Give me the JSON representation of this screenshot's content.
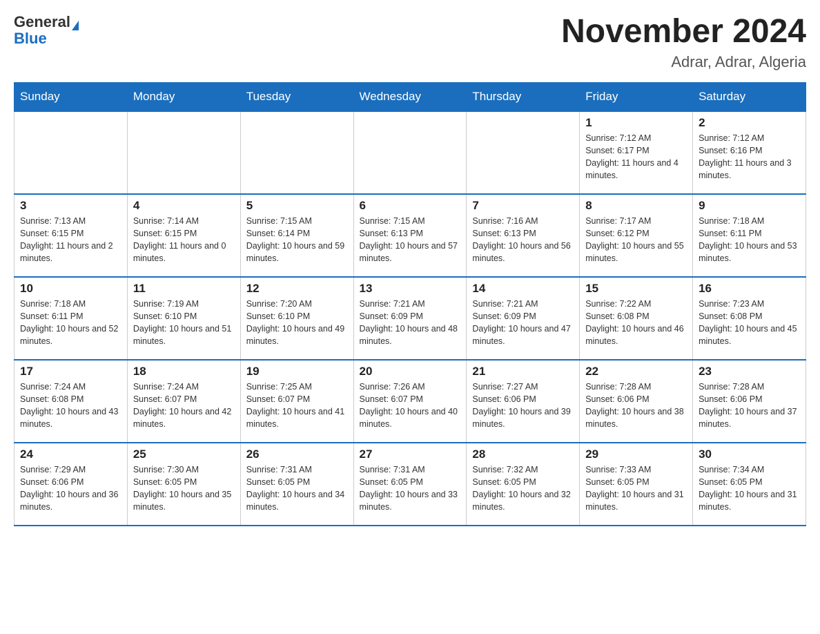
{
  "header": {
    "logo_general": "General",
    "logo_blue": "Blue",
    "month_title": "November 2024",
    "location": "Adrar, Adrar, Algeria"
  },
  "weekdays": [
    "Sunday",
    "Monday",
    "Tuesday",
    "Wednesday",
    "Thursday",
    "Friday",
    "Saturday"
  ],
  "weeks": [
    [
      {
        "day": "",
        "info": ""
      },
      {
        "day": "",
        "info": ""
      },
      {
        "day": "",
        "info": ""
      },
      {
        "day": "",
        "info": ""
      },
      {
        "day": "",
        "info": ""
      },
      {
        "day": "1",
        "info": "Sunrise: 7:12 AM\nSunset: 6:17 PM\nDaylight: 11 hours and 4 minutes."
      },
      {
        "day": "2",
        "info": "Sunrise: 7:12 AM\nSunset: 6:16 PM\nDaylight: 11 hours and 3 minutes."
      }
    ],
    [
      {
        "day": "3",
        "info": "Sunrise: 7:13 AM\nSunset: 6:15 PM\nDaylight: 11 hours and 2 minutes."
      },
      {
        "day": "4",
        "info": "Sunrise: 7:14 AM\nSunset: 6:15 PM\nDaylight: 11 hours and 0 minutes."
      },
      {
        "day": "5",
        "info": "Sunrise: 7:15 AM\nSunset: 6:14 PM\nDaylight: 10 hours and 59 minutes."
      },
      {
        "day": "6",
        "info": "Sunrise: 7:15 AM\nSunset: 6:13 PM\nDaylight: 10 hours and 57 minutes."
      },
      {
        "day": "7",
        "info": "Sunrise: 7:16 AM\nSunset: 6:13 PM\nDaylight: 10 hours and 56 minutes."
      },
      {
        "day": "8",
        "info": "Sunrise: 7:17 AM\nSunset: 6:12 PM\nDaylight: 10 hours and 55 minutes."
      },
      {
        "day": "9",
        "info": "Sunrise: 7:18 AM\nSunset: 6:11 PM\nDaylight: 10 hours and 53 minutes."
      }
    ],
    [
      {
        "day": "10",
        "info": "Sunrise: 7:18 AM\nSunset: 6:11 PM\nDaylight: 10 hours and 52 minutes."
      },
      {
        "day": "11",
        "info": "Sunrise: 7:19 AM\nSunset: 6:10 PM\nDaylight: 10 hours and 51 minutes."
      },
      {
        "day": "12",
        "info": "Sunrise: 7:20 AM\nSunset: 6:10 PM\nDaylight: 10 hours and 49 minutes."
      },
      {
        "day": "13",
        "info": "Sunrise: 7:21 AM\nSunset: 6:09 PM\nDaylight: 10 hours and 48 minutes."
      },
      {
        "day": "14",
        "info": "Sunrise: 7:21 AM\nSunset: 6:09 PM\nDaylight: 10 hours and 47 minutes."
      },
      {
        "day": "15",
        "info": "Sunrise: 7:22 AM\nSunset: 6:08 PM\nDaylight: 10 hours and 46 minutes."
      },
      {
        "day": "16",
        "info": "Sunrise: 7:23 AM\nSunset: 6:08 PM\nDaylight: 10 hours and 45 minutes."
      }
    ],
    [
      {
        "day": "17",
        "info": "Sunrise: 7:24 AM\nSunset: 6:08 PM\nDaylight: 10 hours and 43 minutes."
      },
      {
        "day": "18",
        "info": "Sunrise: 7:24 AM\nSunset: 6:07 PM\nDaylight: 10 hours and 42 minutes."
      },
      {
        "day": "19",
        "info": "Sunrise: 7:25 AM\nSunset: 6:07 PM\nDaylight: 10 hours and 41 minutes."
      },
      {
        "day": "20",
        "info": "Sunrise: 7:26 AM\nSunset: 6:07 PM\nDaylight: 10 hours and 40 minutes."
      },
      {
        "day": "21",
        "info": "Sunrise: 7:27 AM\nSunset: 6:06 PM\nDaylight: 10 hours and 39 minutes."
      },
      {
        "day": "22",
        "info": "Sunrise: 7:28 AM\nSunset: 6:06 PM\nDaylight: 10 hours and 38 minutes."
      },
      {
        "day": "23",
        "info": "Sunrise: 7:28 AM\nSunset: 6:06 PM\nDaylight: 10 hours and 37 minutes."
      }
    ],
    [
      {
        "day": "24",
        "info": "Sunrise: 7:29 AM\nSunset: 6:06 PM\nDaylight: 10 hours and 36 minutes."
      },
      {
        "day": "25",
        "info": "Sunrise: 7:30 AM\nSunset: 6:05 PM\nDaylight: 10 hours and 35 minutes."
      },
      {
        "day": "26",
        "info": "Sunrise: 7:31 AM\nSunset: 6:05 PM\nDaylight: 10 hours and 34 minutes."
      },
      {
        "day": "27",
        "info": "Sunrise: 7:31 AM\nSunset: 6:05 PM\nDaylight: 10 hours and 33 minutes."
      },
      {
        "day": "28",
        "info": "Sunrise: 7:32 AM\nSunset: 6:05 PM\nDaylight: 10 hours and 32 minutes."
      },
      {
        "day": "29",
        "info": "Sunrise: 7:33 AM\nSunset: 6:05 PM\nDaylight: 10 hours and 31 minutes."
      },
      {
        "day": "30",
        "info": "Sunrise: 7:34 AM\nSunset: 6:05 PM\nDaylight: 10 hours and 31 minutes."
      }
    ]
  ]
}
